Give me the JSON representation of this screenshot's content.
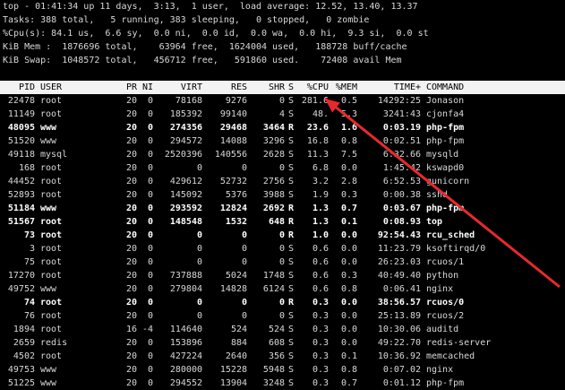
{
  "summary": [
    "top - 01:41:34 up 11 days,  3:13,  1 user,  load average: 12.52, 13.40, 13.37",
    "Tasks: 388 total,   5 running, 383 sleeping,   0 stopped,   0 zombie",
    "%Cpu(s): 84.1 us,  6.6 sy,  0.0 ni,  0.0 id,  0.0 wa,  0.0 hi,  9.3 si,  0.0 st",
    "KiB Mem :  1876696 total,    63964 free,  1624004 used,   188728 buff/cache",
    "KiB Swap:  1048572 total,   456712 free,   591860 used.    72408 avail Mem"
  ],
  "columns": [
    "PID",
    "USER",
    "PR",
    "NI",
    "VIRT",
    "RES",
    "SHR",
    "S",
    "%CPU",
    "%MEM",
    "TIME+",
    "COMMAND"
  ],
  "processes": [
    {
      "pid": "22478",
      "user": "root",
      "pr": "20",
      "ni": "0",
      "virt": "78168",
      "res": "9276",
      "shr": "0",
      "s": "S",
      "cpu": "281.6",
      "mem": "0.5",
      "time": "14292:25",
      "cmd": "Jonason",
      "bold": false
    },
    {
      "pid": "11149",
      "user": "root",
      "pr": "20",
      "ni": "0",
      "virt": "185392",
      "res": "99140",
      "shr": "4",
      "s": "S",
      "cpu": "48.",
      "mem": "5.3",
      "time": "3241:43",
      "cmd": "cjonfa4",
      "bold": false
    },
    {
      "pid": "48095",
      "user": "www",
      "pr": "20",
      "ni": "0",
      "virt": "274356",
      "res": "29468",
      "shr": "3464",
      "s": "R",
      "cpu": "23.6",
      "mem": "1.6",
      "time": "0:03.19",
      "cmd": "php-fpm",
      "bold": true
    },
    {
      "pid": "51520",
      "user": "www",
      "pr": "20",
      "ni": "0",
      "virt": "294572",
      "res": "14088",
      "shr": "3296",
      "s": "S",
      "cpu": "16.8",
      "mem": "0.8",
      "time": "0:02.51",
      "cmd": "php-fpm",
      "bold": false
    },
    {
      "pid": "49118",
      "user": "mysql",
      "pr": "20",
      "ni": "0",
      "virt": "2520396",
      "res": "140556",
      "shr": "2628",
      "s": "S",
      "cpu": "11.3",
      "mem": "7.5",
      "time": "6:32.66",
      "cmd": "mysqld",
      "bold": false
    },
    {
      "pid": "168",
      "user": "root",
      "pr": "20",
      "ni": "0",
      "virt": "0",
      "res": "0",
      "shr": "0",
      "s": "S",
      "cpu": "6.8",
      "mem": "0.0",
      "time": "1:45.42",
      "cmd": "kswapd0",
      "bold": false
    },
    {
      "pid": "44452",
      "user": "root",
      "pr": "20",
      "ni": "0",
      "virt": "429612",
      "res": "52732",
      "shr": "2756",
      "s": "S",
      "cpu": "3.2",
      "mem": "2.8",
      "time": "6:52.53",
      "cmd": "gunicorn",
      "bold": false
    },
    {
      "pid": "52893",
      "user": "root",
      "pr": "20",
      "ni": "0",
      "virt": "145092",
      "res": "5376",
      "shr": "3988",
      "s": "S",
      "cpu": "1.9",
      "mem": "0.3",
      "time": "0:00.38",
      "cmd": "sshd",
      "bold": false
    },
    {
      "pid": "51184",
      "user": "www",
      "pr": "20",
      "ni": "0",
      "virt": "293592",
      "res": "12824",
      "shr": "2692",
      "s": "R",
      "cpu": "1.3",
      "mem": "0.7",
      "time": "0:03.67",
      "cmd": "php-fpm",
      "bold": true
    },
    {
      "pid": "51567",
      "user": "root",
      "pr": "20",
      "ni": "0",
      "virt": "148548",
      "res": "1532",
      "shr": "648",
      "s": "R",
      "cpu": "1.3",
      "mem": "0.1",
      "time": "0:08.93",
      "cmd": "top",
      "bold": true
    },
    {
      "pid": "73",
      "user": "root",
      "pr": "20",
      "ni": "0",
      "virt": "0",
      "res": "0",
      "shr": "0",
      "s": "R",
      "cpu": "1.0",
      "mem": "0.0",
      "time": "92:54.43",
      "cmd": "rcu_sched",
      "bold": true
    },
    {
      "pid": "3",
      "user": "root",
      "pr": "20",
      "ni": "0",
      "virt": "0",
      "res": "0",
      "shr": "0",
      "s": "S",
      "cpu": "0.6",
      "mem": "0.0",
      "time": "11:23.79",
      "cmd": "ksoftirqd/0",
      "bold": false
    },
    {
      "pid": "75",
      "user": "root",
      "pr": "20",
      "ni": "0",
      "virt": "0",
      "res": "0",
      "shr": "0",
      "s": "S",
      "cpu": "0.6",
      "mem": "0.0",
      "time": "26:23.03",
      "cmd": "rcuos/1",
      "bold": false
    },
    {
      "pid": "17270",
      "user": "root",
      "pr": "20",
      "ni": "0",
      "virt": "737888",
      "res": "5024",
      "shr": "1748",
      "s": "S",
      "cpu": "0.6",
      "mem": "0.3",
      "time": "40:49.40",
      "cmd": "python",
      "bold": false
    },
    {
      "pid": "49752",
      "user": "www",
      "pr": "20",
      "ni": "0",
      "virt": "279804",
      "res": "14828",
      "shr": "6124",
      "s": "S",
      "cpu": "0.6",
      "mem": "0.8",
      "time": "0:06.41",
      "cmd": "nginx",
      "bold": false
    },
    {
      "pid": "74",
      "user": "root",
      "pr": "20",
      "ni": "0",
      "virt": "0",
      "res": "0",
      "shr": "0",
      "s": "R",
      "cpu": "0.3",
      "mem": "0.0",
      "time": "38:56.57",
      "cmd": "rcuos/0",
      "bold": true
    },
    {
      "pid": "76",
      "user": "root",
      "pr": "20",
      "ni": "0",
      "virt": "0",
      "res": "0",
      "shr": "0",
      "s": "S",
      "cpu": "0.3",
      "mem": "0.0",
      "time": "25:13.89",
      "cmd": "rcuos/2",
      "bold": false
    },
    {
      "pid": "1894",
      "user": "root",
      "pr": "16",
      "ni": "-4",
      "virt": "114640",
      "res": "524",
      "shr": "524",
      "s": "S",
      "cpu": "0.3",
      "mem": "0.0",
      "time": "10:30.06",
      "cmd": "auditd",
      "bold": false
    },
    {
      "pid": "2659",
      "user": "redis",
      "pr": "20",
      "ni": "0",
      "virt": "153896",
      "res": "884",
      "shr": "608",
      "s": "S",
      "cpu": "0.3",
      "mem": "0.0",
      "time": "49:22.70",
      "cmd": "redis-server",
      "bold": false
    },
    {
      "pid": "4502",
      "user": "root",
      "pr": "20",
      "ni": "0",
      "virt": "427224",
      "res": "2640",
      "shr": "356",
      "s": "S",
      "cpu": "0.3",
      "mem": "0.1",
      "time": "10:36.92",
      "cmd": "memcached",
      "bold": false
    },
    {
      "pid": "49753",
      "user": "www",
      "pr": "20",
      "ni": "0",
      "virt": "280000",
      "res": "15228",
      "shr": "5948",
      "s": "S",
      "cpu": "0.3",
      "mem": "0.8",
      "time": "0:07.02",
      "cmd": "nginx",
      "bold": false
    },
    {
      "pid": "51225",
      "user": "www",
      "pr": "20",
      "ni": "0",
      "virt": "294552",
      "res": "13904",
      "shr": "3248",
      "s": "S",
      "cpu": "0.3",
      "mem": "0.7",
      "time": "0:01.12",
      "cmd": "php-fpm",
      "bold": false
    }
  ],
  "annotation": {
    "arrow_color": "#e8292c"
  }
}
